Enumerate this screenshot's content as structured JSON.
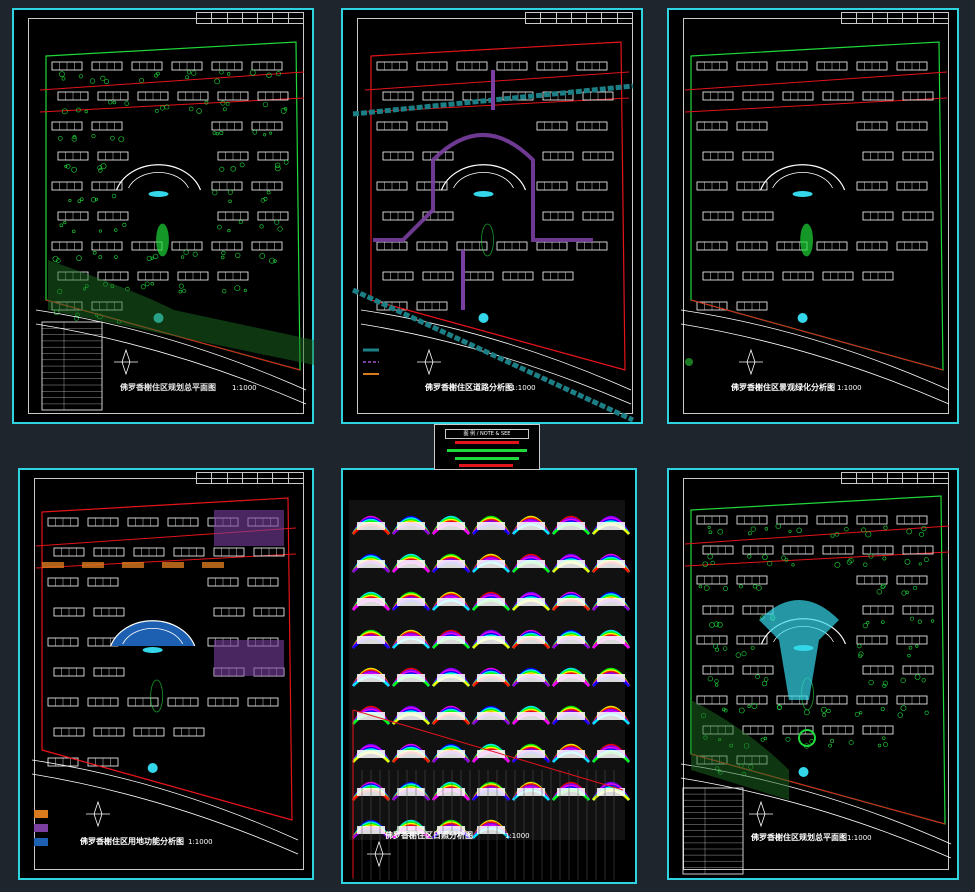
{
  "sheets": [
    {
      "id": "sheet-1",
      "title": "佛罗香榭住区规划总平面图",
      "scale": "1:1000",
      "theme": "green"
    },
    {
      "id": "sheet-2",
      "title": "佛罗香榭住区道路分析图",
      "scale": "1:1000",
      "theme": "road"
    },
    {
      "id": "sheet-3",
      "title": "佛罗香榭住区景观绿化分析图",
      "scale": "1:1000",
      "theme": "outline"
    },
    {
      "id": "sheet-4",
      "title": "佛罗香榭住区用地功能分析图",
      "scale": "1:1000",
      "theme": "landuse"
    },
    {
      "id": "sheet-5",
      "title": "佛罗香榭住区日照分析图",
      "scale": "1:1000",
      "theme": "sunlight"
    },
    {
      "id": "sheet-6",
      "title": "佛罗香榭住区规划总平面图",
      "scale": "1:1000",
      "theme": "green2"
    }
  ],
  "center_legend": {
    "heading": "图 例 / NOTE & SEE"
  },
  "colors": {
    "sheet_border": "#2fd3e0",
    "building": "#ffffff",
    "green": "#1fd83a",
    "red_line": "#e3141a",
    "road_teal": "#1d7f86",
    "purple": "#7a3fa0",
    "orange": "#d97a1f",
    "blue": "#1d5fb0",
    "cyan": "#34d7ea"
  }
}
